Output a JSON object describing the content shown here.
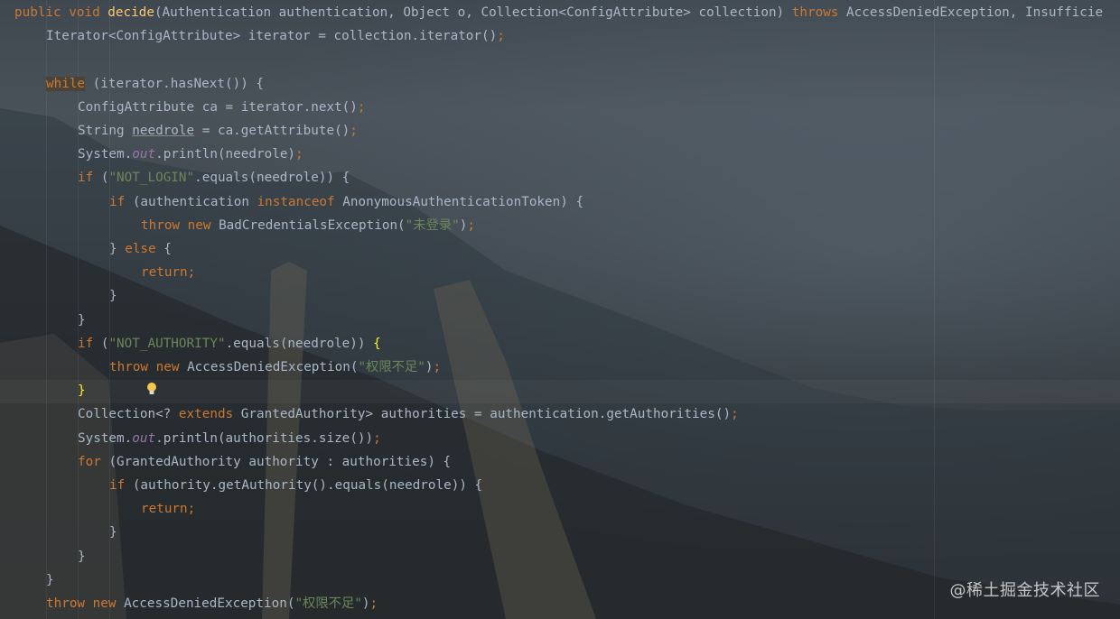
{
  "editor": {
    "theme_colors": {
      "keyword": "#cc7832",
      "string": "#6a8759",
      "method": "#ffc66d",
      "static_field": "#9876aa",
      "text": "#a9b7c6"
    },
    "lines": [
      {
        "parts": [
          [
            "kw",
            "public void "
          ],
          [
            "fn",
            "decide"
          ],
          [
            "t",
            "(Authentication authentication, Object o, Collection<ConfigAttribute> collection) "
          ],
          [
            "kw",
            "throws "
          ],
          [
            "t",
            "AccessDeniedException, Insufficie"
          ]
        ]
      },
      {
        "parts": [
          [
            "t",
            "Iterator<ConfigAttribute> iterator = collection.iterator()"
          ],
          [
            "semi",
            ";"
          ]
        ]
      },
      {
        "parts": []
      },
      {
        "parts": [
          [
            "wh",
            "while"
          ],
          [
            "t",
            " (iterator.hasNext()) {"
          ]
        ]
      },
      {
        "parts": [
          [
            "t",
            "ConfigAttribute ca = iterator.next()"
          ],
          [
            "semi",
            ";"
          ]
        ]
      },
      {
        "parts": [
          [
            "t",
            "String "
          ],
          [
            "ul",
            "needrole"
          ],
          [
            "t",
            " = ca.getAttribute()"
          ],
          [
            "semi",
            ";"
          ]
        ]
      },
      {
        "parts": [
          [
            "t",
            "System."
          ],
          [
            "it",
            "out"
          ],
          [
            "t",
            ".println(needrole)"
          ],
          [
            "semi",
            ";"
          ]
        ]
      },
      {
        "parts": [
          [
            "kw",
            "if "
          ],
          [
            "t",
            "("
          ],
          [
            "str",
            "\"NOT_LOGIN\""
          ],
          [
            "t",
            ".equals(needrole)) {"
          ]
        ]
      },
      {
        "parts": [
          [
            "kw",
            "if "
          ],
          [
            "t",
            "(authentication "
          ],
          [
            "kw",
            "instanceof "
          ],
          [
            "t",
            "AnonymousAuthenticationToken) {"
          ]
        ]
      },
      {
        "parts": [
          [
            "kw",
            "throw new "
          ],
          [
            "t",
            "BadCredentialsException("
          ],
          [
            "str",
            "\"未登录\""
          ],
          [
            "t",
            ")"
          ],
          [
            "semi",
            ";"
          ]
        ]
      },
      {
        "parts": [
          [
            "t",
            "} "
          ],
          [
            "kw",
            "else "
          ],
          [
            "t",
            "{"
          ]
        ]
      },
      {
        "parts": [
          [
            "kw",
            "return"
          ],
          [
            "semi",
            ";"
          ]
        ]
      },
      {
        "parts": [
          [
            "t",
            "}"
          ]
        ]
      },
      {
        "parts": [
          [
            "t",
            "}"
          ]
        ]
      },
      {
        "parts": [
          [
            "kw",
            "if "
          ],
          [
            "t",
            "("
          ],
          [
            "str",
            "\"NOT_AUTHORITY\""
          ],
          [
            "t",
            ".equals(needrole)) "
          ],
          [
            "br",
            "{"
          ]
        ]
      },
      {
        "parts": [
          [
            "kw",
            "throw new "
          ],
          [
            "t",
            "AccessDeniedException("
          ],
          [
            "str",
            "\"权限不足\""
          ],
          [
            "t",
            ")"
          ],
          [
            "semi",
            ";"
          ]
        ]
      },
      {
        "parts": [
          [
            "br",
            "}"
          ]
        ]
      },
      {
        "parts": [
          [
            "t",
            "Collection<? "
          ],
          [
            "kw",
            "extends "
          ],
          [
            "t",
            "GrantedAuthority> authorities = authentication.getAuthorities()"
          ],
          [
            "semi",
            ";"
          ]
        ]
      },
      {
        "parts": [
          [
            "t",
            "System."
          ],
          [
            "it",
            "out"
          ],
          [
            "t",
            ".println(authorities.size())"
          ],
          [
            "semi",
            ";"
          ]
        ]
      },
      {
        "parts": [
          [
            "kw",
            "for "
          ],
          [
            "t",
            "(GrantedAuthority authority : authorities) {"
          ]
        ]
      },
      {
        "parts": [
          [
            "kw",
            "if "
          ],
          [
            "t",
            "(authority.getAuthority().equals(needrole)) {"
          ]
        ]
      },
      {
        "parts": [
          [
            "kw",
            "return"
          ],
          [
            "semi",
            ";"
          ]
        ]
      },
      {
        "parts": [
          [
            "t",
            "}"
          ]
        ]
      },
      {
        "parts": [
          [
            "t",
            "}"
          ]
        ]
      },
      {
        "parts": [
          [
            "t",
            "}"
          ]
        ]
      },
      {
        "parts": [
          [
            "kw",
            "throw new "
          ],
          [
            "t",
            "AccessDeniedException("
          ],
          [
            "str",
            "\"权限不足\""
          ],
          [
            "t",
            ")"
          ],
          [
            "semi",
            ";"
          ]
        ]
      }
    ]
  },
  "watermark": "@稀土掘金技术社区",
  "icons": {
    "intention": "lightbulb-icon"
  }
}
